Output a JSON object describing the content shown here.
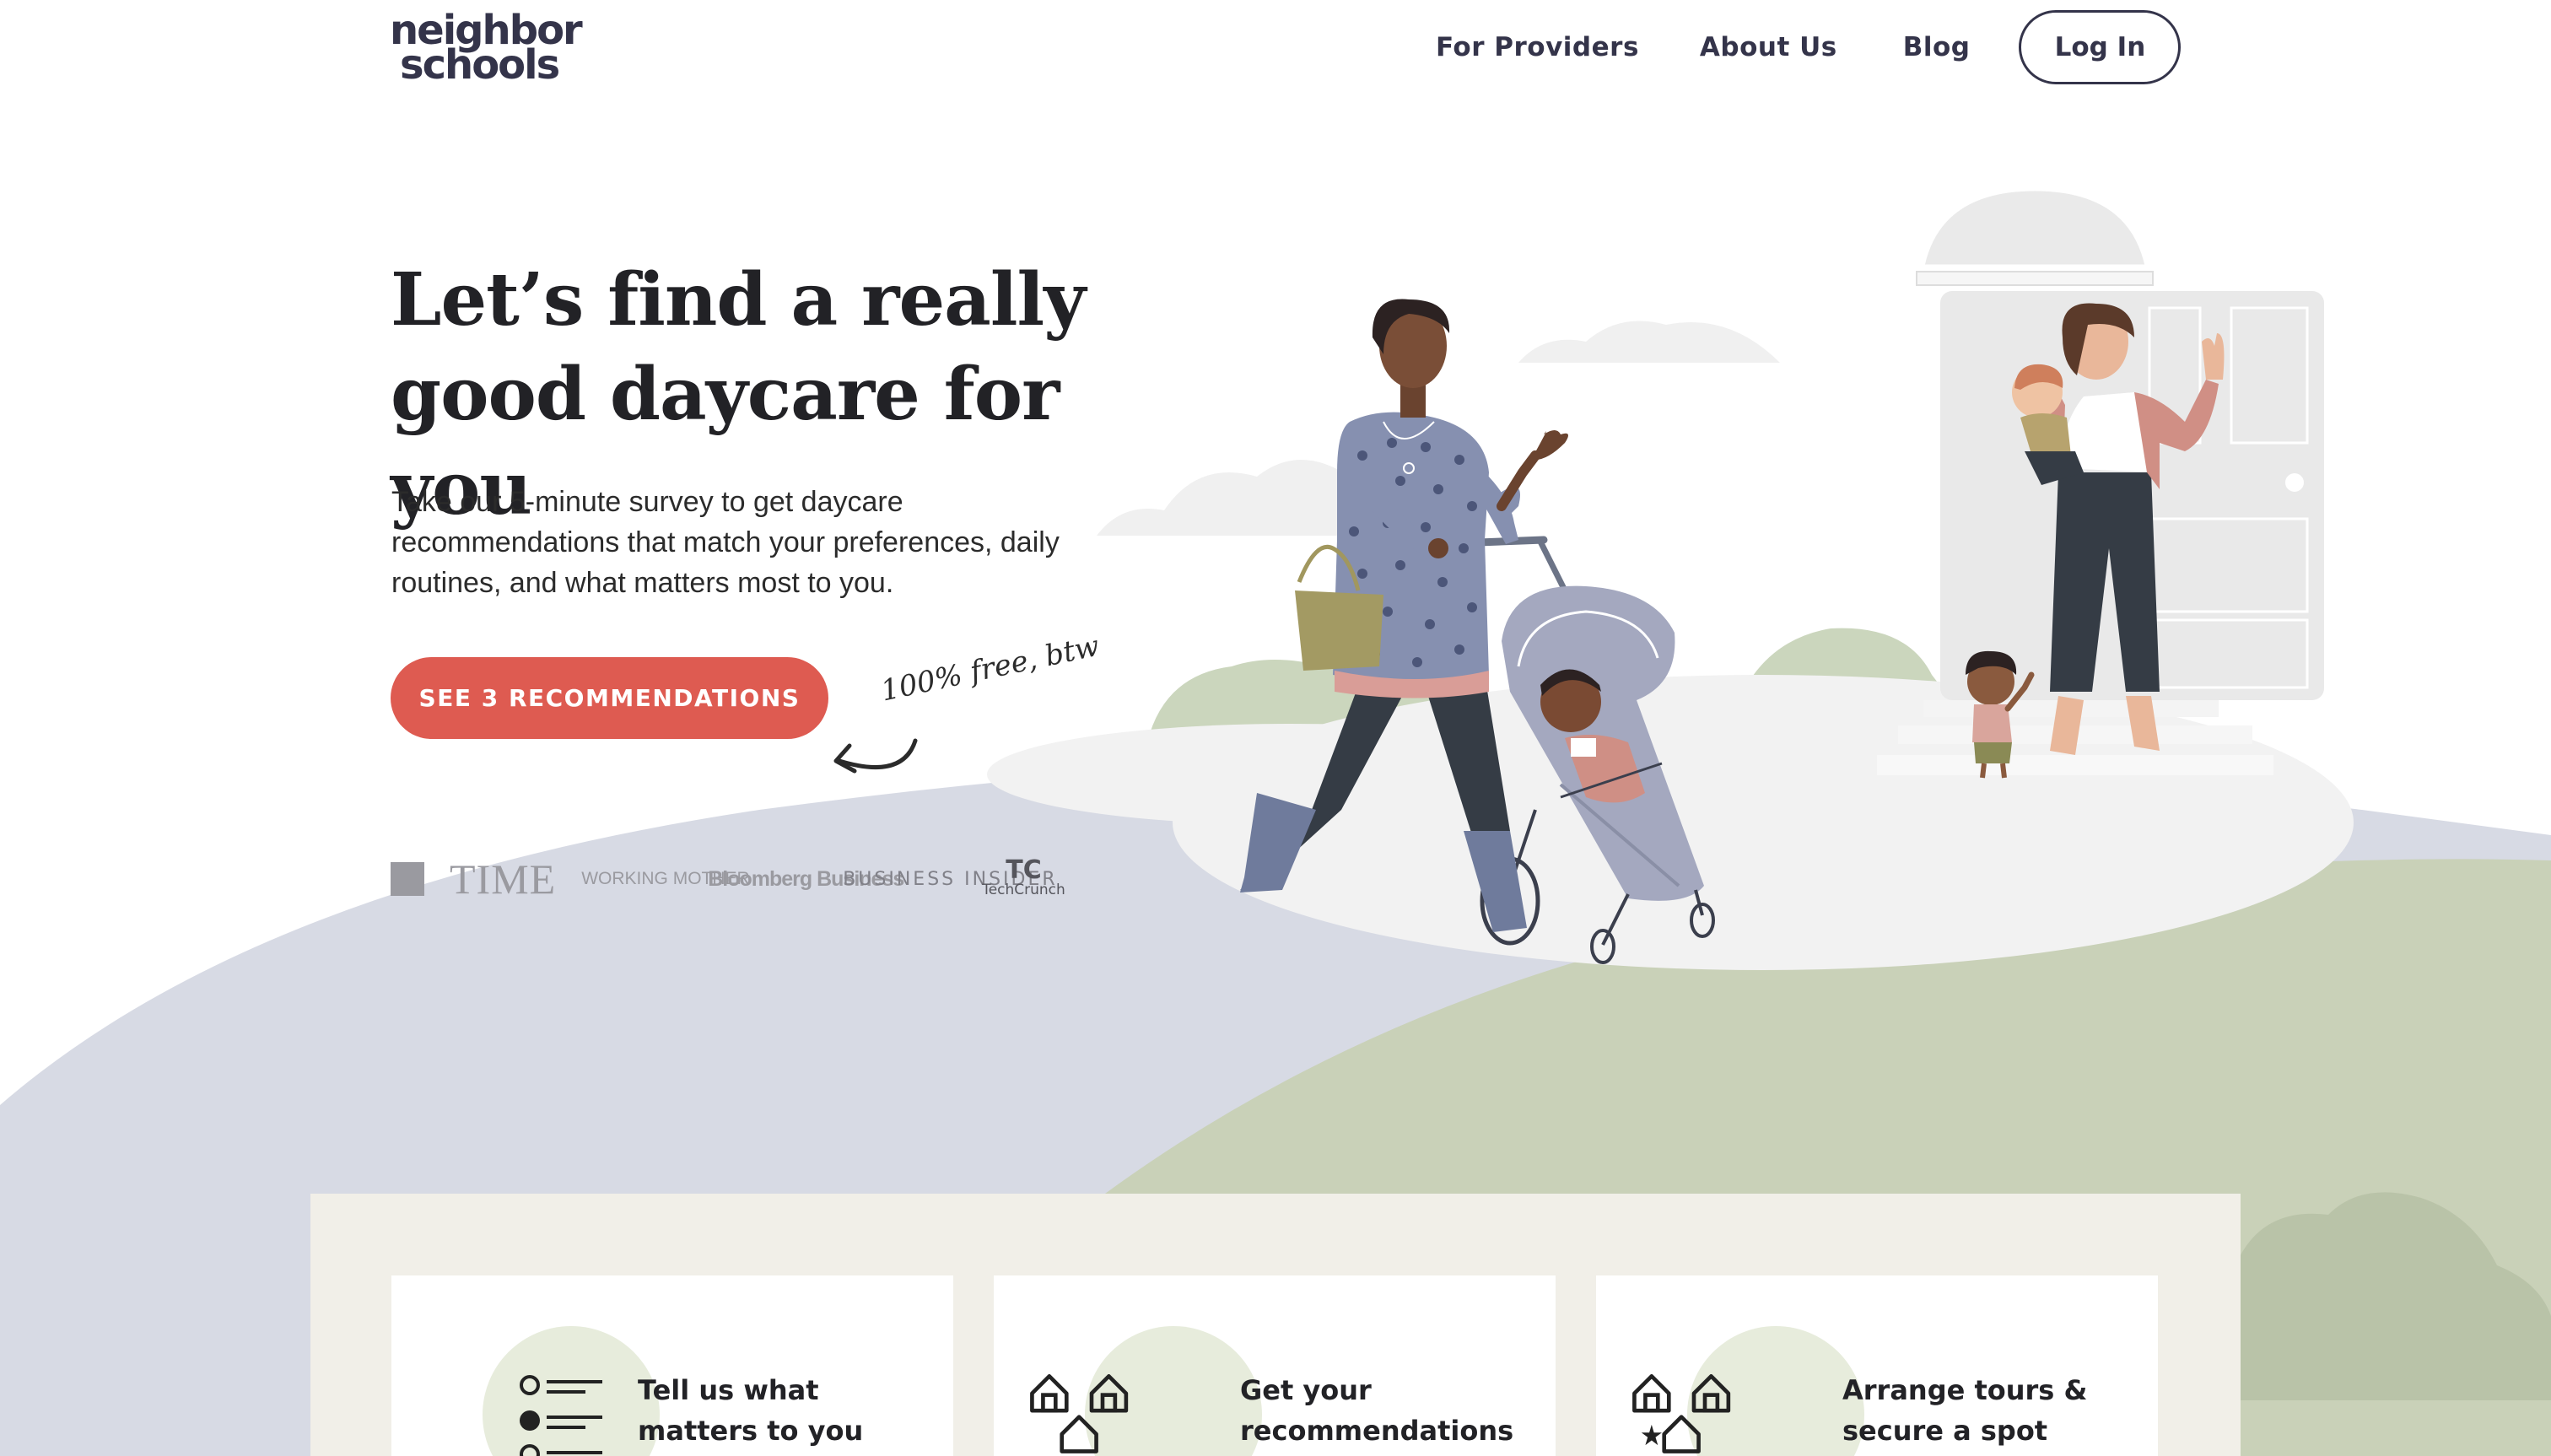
{
  "header": {
    "logo": {
      "line1": "neighbor",
      "line2": "schools"
    },
    "nav": [
      {
        "label": "For Providers"
      },
      {
        "label": "About Us"
      },
      {
        "label": "Blog"
      }
    ],
    "login_label": "Log In"
  },
  "hero": {
    "title": "Let’s find a really good daycare for you",
    "subtitle": "Take our 5-minute survey to get daycare recommendations that match your preferences, daily routines, and what matters most to you.",
    "cta_label": "SEE 3 RECOMMENDATIONS",
    "free_note": "100% free, btw"
  },
  "press": {
    "time": "TIME",
    "working_mother": "WORKING MOTHER",
    "bloomberg": "Bloomberg Business",
    "business_insider": "BUSINESS INSIDER",
    "techcrunch_mark": "TC",
    "techcrunch": "TechCrunch"
  },
  "steps": [
    {
      "title": "Tell us what matters to you",
      "icon": "checklist-icon"
    },
    {
      "title": "Get your recommendations",
      "icon": "houses-icon"
    },
    {
      "title": "Arrange tours & secure a spot",
      "icon": "houses-star-icon"
    }
  ],
  "colors": {
    "brand_navy": "#34344a",
    "cta_red": "#de5b51",
    "hill_blue": "#d7dae4",
    "hill_green": "#c9d1b8",
    "panel_beige": "#f1efe8"
  }
}
